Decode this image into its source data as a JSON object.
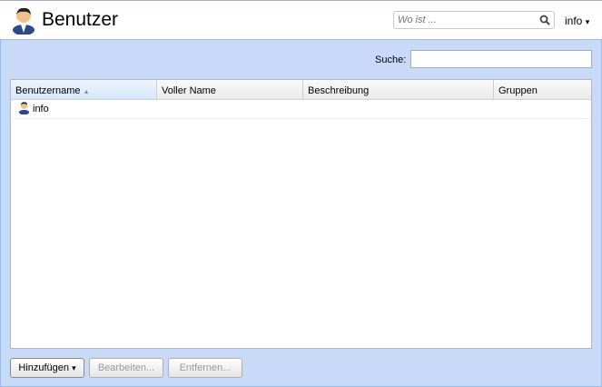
{
  "header": {
    "title": "Benutzer",
    "where_placeholder": "Wo ist ...",
    "user_menu": "info",
    "user_menu_arrow": "▾"
  },
  "search": {
    "label": "Suche:",
    "value": ""
  },
  "grid": {
    "columns": [
      {
        "label": "Benutzername",
        "sort": "▲"
      },
      {
        "label": "Voller Name"
      },
      {
        "label": "Beschreibung"
      },
      {
        "label": "Gruppen"
      }
    ],
    "rows": [
      {
        "username": "info",
        "full_name": "",
        "description": "",
        "groups": ""
      }
    ]
  },
  "buttons": {
    "add": "Hinzufügen",
    "add_arrow": "▾",
    "edit": "Bearbeiten...",
    "remove": "Entfernen..."
  }
}
